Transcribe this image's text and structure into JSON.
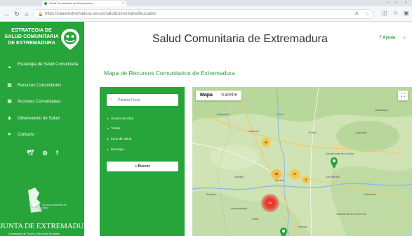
{
  "browser": {
    "tab_title": "Salud Comunitaria de Extremadura",
    "url": "https://saludextremadura.ses.es/saludcomunitaria/buscador"
  },
  "header": {
    "logo_lines": [
      "ESTRATEGIA DE",
      "SALUD COMUNITARIA",
      "DE EXTREMADURA"
    ],
    "title": "Salud Comunitaria de Extremadura",
    "help_label": "? Ayuda"
  },
  "sidebar": {
    "items": [
      {
        "label": "Estrategia de Salud Comunitaria",
        "icon": "leaf-icon"
      },
      {
        "label": "Recursos Comunitarios",
        "icon": "grid-icon"
      },
      {
        "label": "Acciones Comunitarias",
        "icon": "clipboard-icon"
      },
      {
        "label": "Observatorio de Salud",
        "icon": "person-icon"
      },
      {
        "label": "Contacto",
        "icon": "rocket-icon"
      }
    ],
    "ses_label": "SES",
    "ses_sub": "Servicio Extremeño de Salud",
    "junta": "JUNTA DE EXTREMADURA",
    "junta_sub": "Consejería de Salud y Servicios Sociales"
  },
  "main": {
    "title": "Mapa de Recursos Comunitarios de Extremadura",
    "keyword_placeholder": "Palabra Clave",
    "filters": [
      "Grupos de edad",
      "Temas",
      "Zona de Salud",
      "Municipio"
    ],
    "search_label": "Buscar"
  },
  "map": {
    "tabs": [
      "Mapa",
      "Satélite"
    ],
    "clusters": [
      "46",
      "56",
      "79",
      "31",
      "9"
    ],
    "places": [
      "Cáceres",
      "Trujillo",
      "Mérida",
      "Badajoz",
      "Navalmoral de la Mata",
      "Don Benito",
      "Zafra",
      "Llerena",
      "Villanueva de la Serena",
      "Plasencia",
      "Coria",
      "Almendralejo",
      "Montijo",
      "Logrosán",
      "Guadalupe",
      "Castuera"
    ]
  }
}
